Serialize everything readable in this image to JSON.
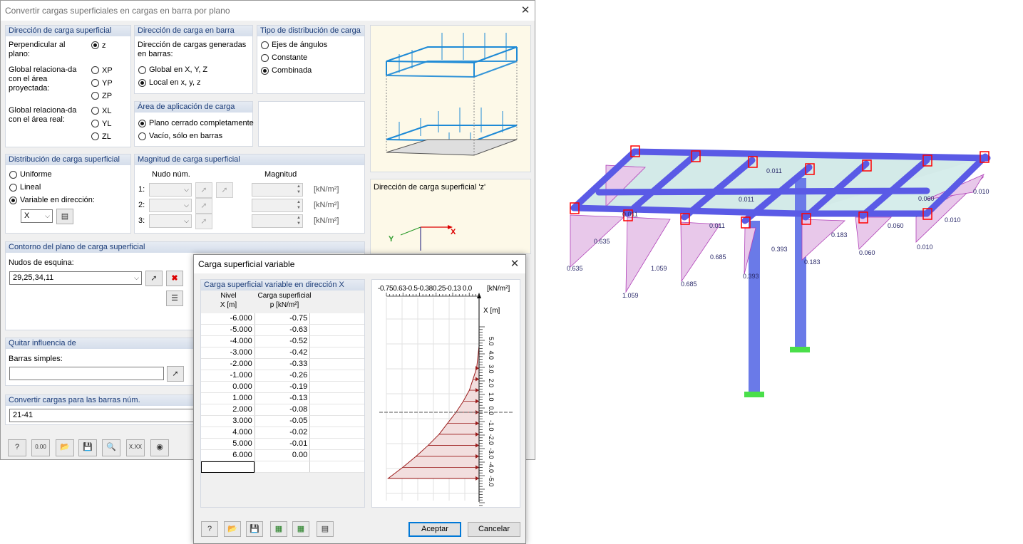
{
  "main": {
    "title": "Convertir cargas superficiales en cargas en barra por plano",
    "dir_superficial": {
      "header": "Dirección de carga superficial",
      "perp_label": "Perpendicular al plano:",
      "opt_z": "z",
      "global_proj_label": "Global relaciona-da con el área proyectada:",
      "opt_xp": "XP",
      "opt_yp": "YP",
      "opt_zp": "ZP",
      "global_real_label": "Global relaciona-da con el área real:",
      "opt_xl": "XL",
      "opt_yl": "YL",
      "opt_zl": "ZL"
    },
    "dir_barra": {
      "header": "Dirección de carga en barra",
      "desc": "Dirección de cargas generadas en barras:",
      "opt_global": "Global en X, Y, Z",
      "opt_local": "Local en x, y, z"
    },
    "tipo_dist": {
      "header": "Tipo de distribución de carga",
      "opt_ejes": "Ejes de ángulos",
      "opt_constante": "Constante",
      "opt_combinada": "Combinada"
    },
    "area_aplic": {
      "header": "Área de aplicación de carga",
      "opt_cerrado": "Plano cerrado completamente",
      "opt_vacio": "Vacío, sólo en barras"
    },
    "distribucion": {
      "header": "Distribución de carga superficial",
      "opt_uniforme": "Uniforme",
      "opt_lineal": "Lineal",
      "opt_variable": "Variable en dirección:",
      "dir_value": "X"
    },
    "magnitud": {
      "header": "Magnitud de carga superficial",
      "col_nudo": "Nudo núm.",
      "col_mag": "Magnitud",
      "row1": "1:",
      "row2": "2:",
      "row3": "3:",
      "unit": "[kN/m²]"
    },
    "contorno": {
      "header": "Contorno del plano de carga superficial",
      "label": "Nudos de esquina:",
      "value": "29,25,34,11"
    },
    "quitar": {
      "header": "Quitar influencia de",
      "label": "Barras simples:",
      "value": ""
    },
    "convertir": {
      "header": "Convertir cargas para las barras núm.",
      "value": "21-41"
    },
    "preview_label": "Dirección de carga superficial 'z'",
    "axis_y": "Y",
    "axis_x": "X",
    "tool_000": "0.00",
    "tool_xxx": "X.XX"
  },
  "sub": {
    "title": "Carga superficial variable",
    "section": "Carga superficial variable en dirección X",
    "col1_h1": "Nivel",
    "col1_h2": "X [m]",
    "col2_h1": "Carga superficial",
    "col2_h2": "p [kN/m²]",
    "rows": [
      {
        "x": "-6.000",
        "p": "-0.75"
      },
      {
        "x": "-5.000",
        "p": "-0.63"
      },
      {
        "x": "-4.000",
        "p": "-0.52"
      },
      {
        "x": "-3.000",
        "p": "-0.42"
      },
      {
        "x": "-2.000",
        "p": "-0.33"
      },
      {
        "x": "-1.000",
        "p": "-0.26"
      },
      {
        "x": "0.000",
        "p": "-0.19"
      },
      {
        "x": "1.000",
        "p": "-0.13"
      },
      {
        "x": "2.000",
        "p": "-0.08"
      },
      {
        "x": "3.000",
        "p": "-0.05"
      },
      {
        "x": "4.000",
        "p": "-0.02"
      },
      {
        "x": "5.000",
        "p": "-0.01"
      },
      {
        "x": "6.000",
        "p": "0.00"
      }
    ],
    "graph_top_ticks": "-0.750.63-0.5-0.380.25-0.13 0.0",
    "graph_unit": "[kN/m²]",
    "graph_axis": "X [m]",
    "graph_side_ticks": [
      "5.0",
      "4.0",
      "3.0",
      "2.0",
      "1.0",
      "0.0",
      "-1.0",
      "-2.0",
      "-3.0",
      "-4.0",
      "-5.0"
    ],
    "ok": "Aceptar",
    "cancel": "Cancelar"
  },
  "model_labels": [
    "0.011",
    "0.060",
    "0.010",
    "0.011",
    "0.060",
    "0.010",
    "0.635",
    "0.635",
    "1.059",
    "1.059",
    "0.685",
    "0.685",
    "0.393",
    "0.393",
    "0.183",
    "0.183",
    "0.060",
    "0.010",
    "0.011",
    "0.011"
  ],
  "colors": {
    "accent": "#1b3c78",
    "header_bg": "#dae2ee",
    "beam": "#5a5ae6",
    "load": "#b040b8",
    "load_fill": "#e8c8ea",
    "column": "#6a7ae8",
    "support": "#4adf4a",
    "red": "#ff0000"
  }
}
